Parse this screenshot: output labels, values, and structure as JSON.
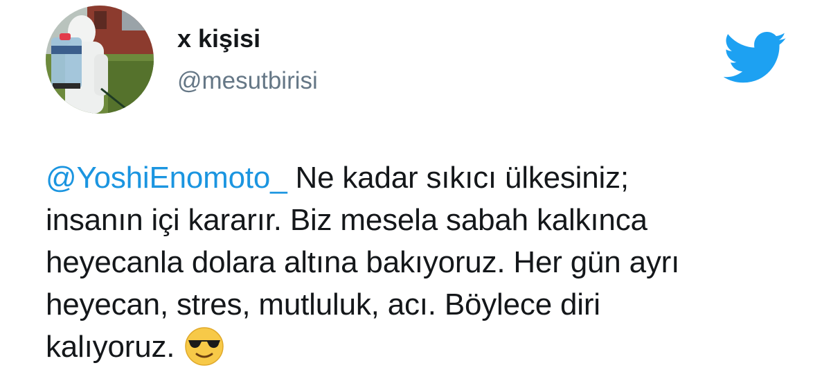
{
  "user": {
    "display_name": "x kişisi",
    "handle": "@mesutbirisi"
  },
  "icons": {
    "logo": "twitter-bird-icon",
    "emoji": "sunglasses-face-emoji",
    "brand_color": "#1da1f2",
    "mention_color": "#1b95e0"
  },
  "tweet": {
    "mention": "@YoshiEnomoto_",
    "line1_rest": " Ne kadar sıkıcı ülkesiniz;",
    "line2": "insanın içi kararır. Biz  mesela sabah kalkınca",
    "line3": "heyecanla dolara altına bakıyoruz. Her gün ayrı",
    "line4": "heyecan, stres, mutluluk, acı. Böylece diri",
    "line5": "kalıyoruz."
  }
}
